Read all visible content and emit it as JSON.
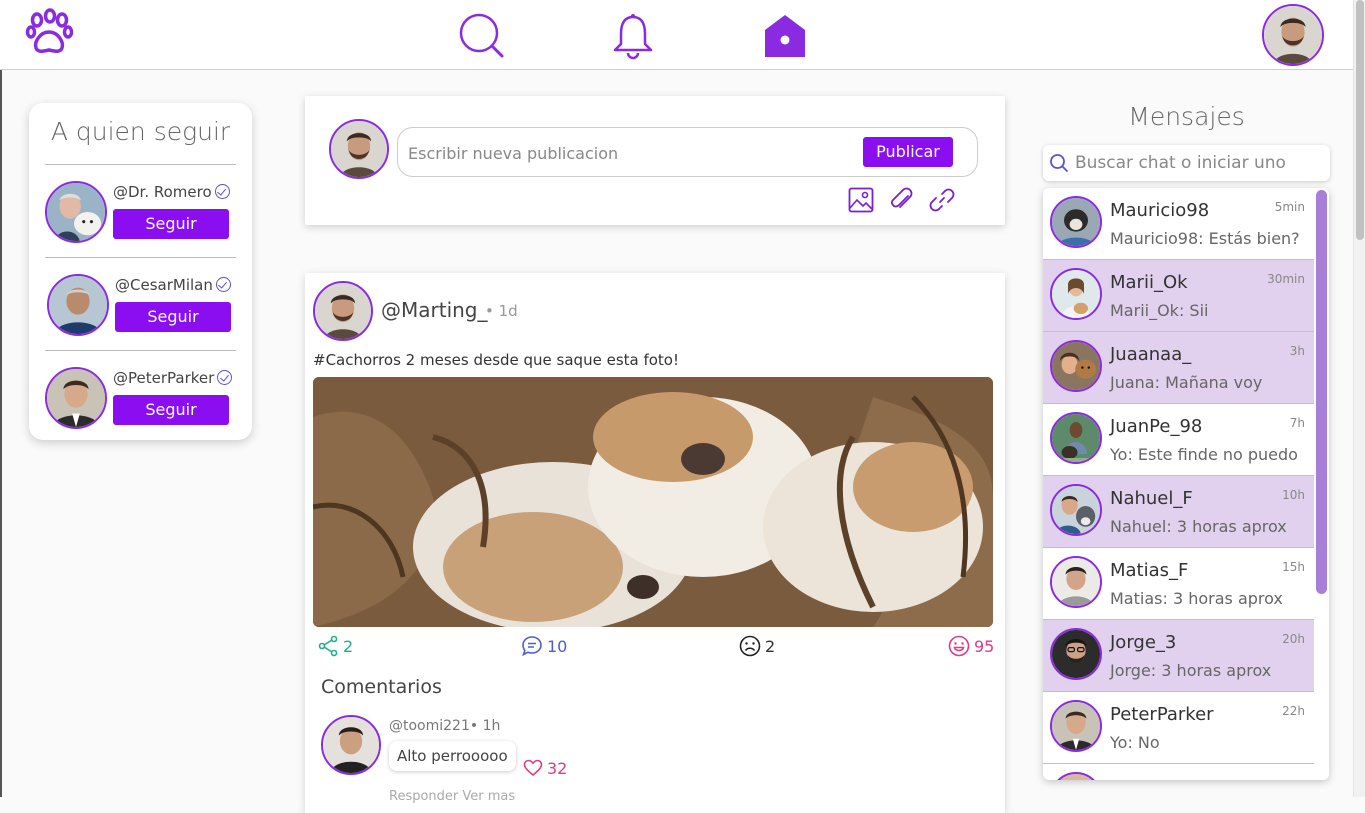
{
  "topbar": {
    "logo_icon": "paw-icon",
    "nav": [
      "search-icon",
      "bell-icon",
      "home-icon"
    ],
    "accent": "#8a2be2"
  },
  "follow": {
    "title": "A quien seguir",
    "items": [
      {
        "handle": "@Dr. Romero",
        "button": "Seguir"
      },
      {
        "handle": "@CesarMilan",
        "button": "Seguir"
      },
      {
        "handle": "@PeterParker",
        "button": "Seguir"
      }
    ]
  },
  "composer": {
    "placeholder": "Escribir nueva publicacion",
    "publish": "Publicar",
    "tools": [
      "image-icon",
      "paperclip-icon",
      "link-icon"
    ]
  },
  "post": {
    "author": "@Marting_",
    "time": "• 1d",
    "text": "#Cachorros 2 meses desde que saque esta foto!",
    "stats": {
      "shares": "2",
      "comments": "10",
      "sad": "2",
      "likes": "95"
    },
    "comments_title": "Comentarios",
    "comment": {
      "author": "@toomi221",
      "time": "• 1h",
      "text": "Alto perrooooo",
      "likes": "32"
    },
    "next_comment": "Responder   Ver mas"
  },
  "messages": {
    "title": "Mensajes",
    "search_placeholder": "Buscar chat o iniciar uno",
    "items": [
      {
        "name": "Mauricio98",
        "time": "5min",
        "preview": "Mauricio98: Estás bien?"
      },
      {
        "name": "Marii_Ok",
        "time": "30min",
        "preview": "Marii_Ok: Sii"
      },
      {
        "name": "Juaanaa_",
        "time": "3h",
        "preview": "Juana: Mañana voy"
      },
      {
        "name": "JuanPe_98",
        "time": "7h",
        "preview": "Yo: Este finde no puedo"
      },
      {
        "name": "Nahuel_F",
        "time": "10h",
        "preview": "Nahuel: 3 horas aprox"
      },
      {
        "name": "Matias_F",
        "time": "15h",
        "preview": "Matias: 3 horas aprox"
      },
      {
        "name": "Jorge_3",
        "time": "20h",
        "preview": "Jorge: 3 horas aprox"
      },
      {
        "name": "PeterParker",
        "time": "22h",
        "preview": "Yo: No"
      }
    ]
  }
}
